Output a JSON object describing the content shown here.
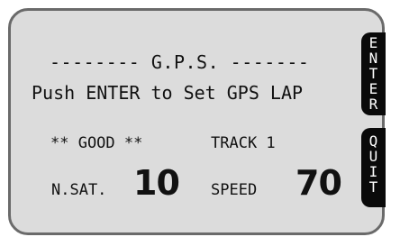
{
  "screen": {
    "title": "-------- G.P.S. -------",
    "prompt": "Push ENTER to Set GPS LAP",
    "status": "** GOOD **",
    "track": "TRACK 1",
    "satellites_label": "N.SAT.",
    "satellites_value": "10",
    "speed_label": "SPEED",
    "speed_value": "70"
  },
  "softkeys": {
    "enter": [
      "E",
      "N",
      "T",
      "E",
      "R"
    ],
    "quit": [
      "Q",
      "U",
      "I",
      "T"
    ]
  },
  "colors": {
    "background": "#dcdcdc",
    "border": "#6a6a6a",
    "text": "#111111",
    "key_fill": "#0a0a0a",
    "key_text": "#ffffff"
  }
}
